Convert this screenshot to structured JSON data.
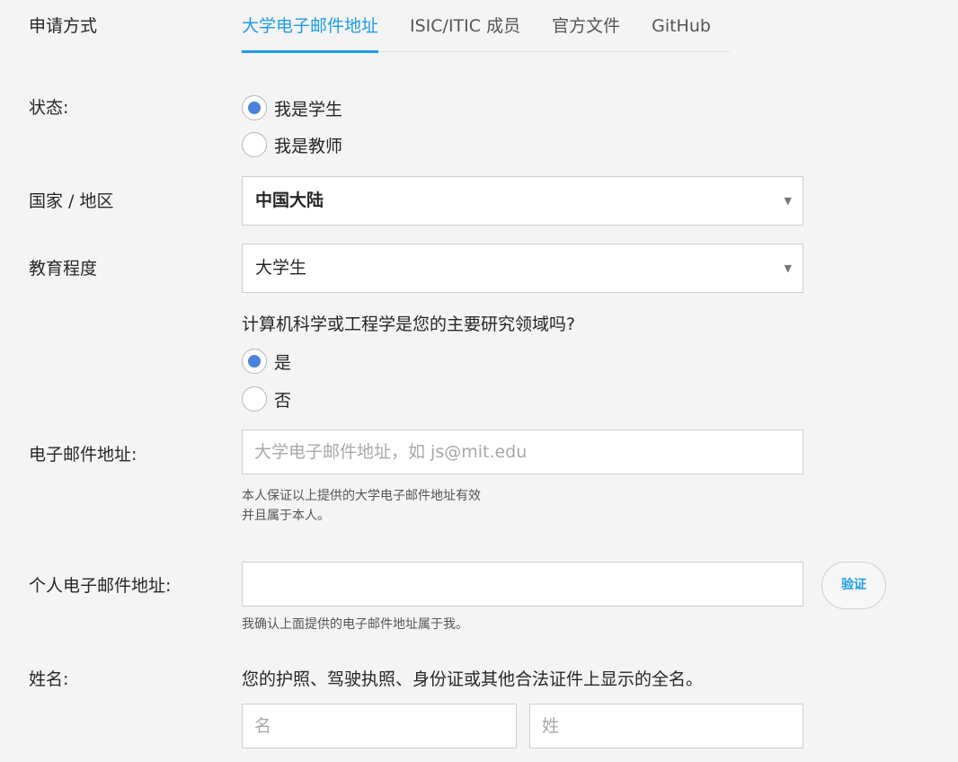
{
  "apply": {
    "label": "申请方式",
    "tabs": [
      "大学电子邮件地址",
      "ISIC/ITIC 成员",
      "官方文件",
      "GitHub"
    ],
    "active_tab": 0
  },
  "status": {
    "label": "状态:",
    "options": [
      {
        "text": "我是学生",
        "checked": true
      },
      {
        "text": "我是教师",
        "checked": false
      }
    ]
  },
  "country": {
    "label": "国家 / 地区",
    "value": "中国大陆"
  },
  "education": {
    "label": "教育程度",
    "value": "大学生"
  },
  "cs_question": {
    "text": "计算机科学或工程学是您的主要研究领域吗?",
    "options": [
      {
        "text": "是",
        "checked": true
      },
      {
        "text": "否",
        "checked": false
      }
    ]
  },
  "uni_email": {
    "label": "电子邮件地址:",
    "placeholder": "大学电子邮件地址，如 js@mit.edu",
    "value": "",
    "helper_line1": "本人保证以上提供的大学电子邮件地址有效",
    "helper_line2": "并且属于本人。"
  },
  "personal_email": {
    "label": "个人电子邮件地址:",
    "value": "",
    "verify_label": "验证",
    "helper": "我确认上面提供的电子邮件地址属于我。"
  },
  "name": {
    "label": "姓名:",
    "hint": "您的护照、驾驶执照、身份证或其他合法证件上显示的全名。",
    "first_placeholder": "名",
    "last_placeholder": "姓"
  },
  "colors": {
    "accent": "#1e9be8",
    "radio_fill": "#4a82dc",
    "background": "#f4f4f4"
  }
}
